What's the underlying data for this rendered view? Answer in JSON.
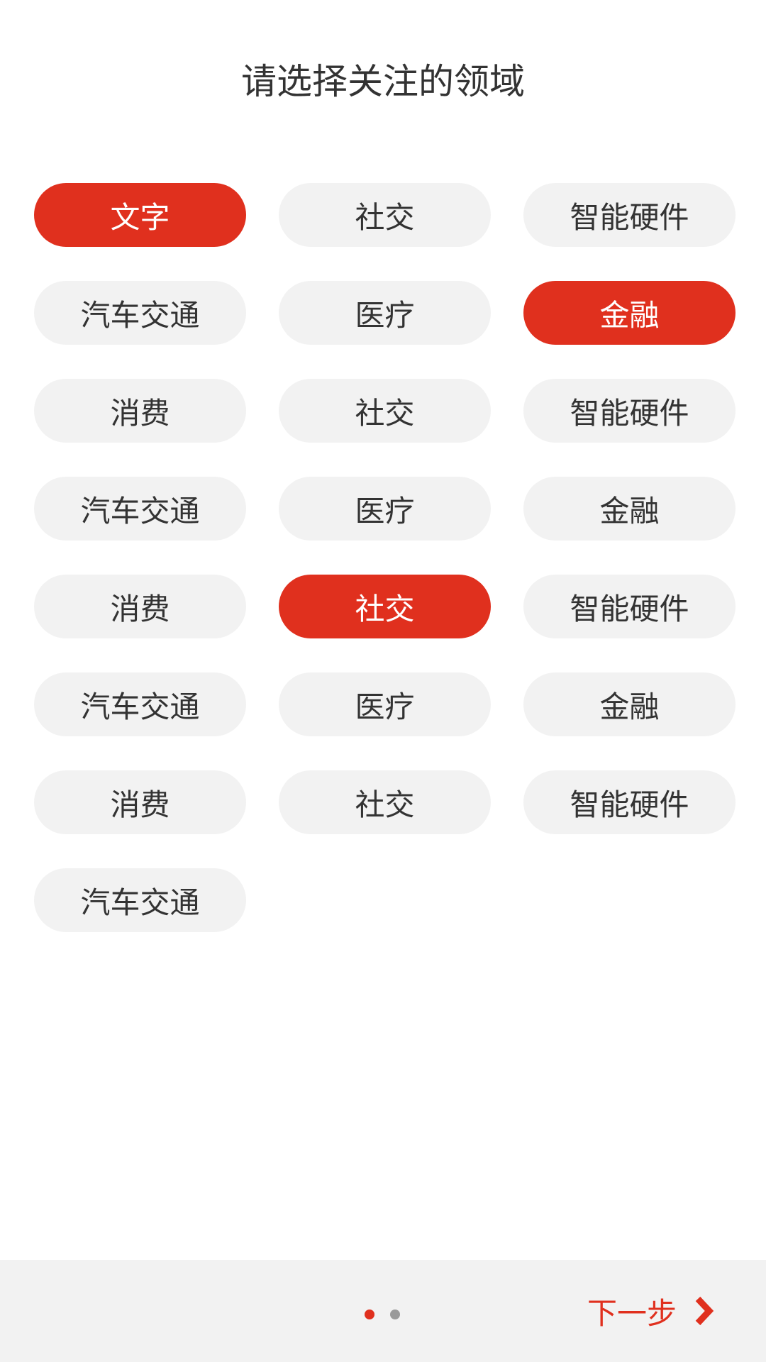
{
  "title": "请选择关注的领域",
  "colors": {
    "accent": "#e0301e",
    "tag_bg": "#f2f2f2",
    "footer_bg": "#f2f2f2"
  },
  "tags": [
    {
      "label": "文字",
      "selected": true
    },
    {
      "label": "社交",
      "selected": false
    },
    {
      "label": "智能硬件",
      "selected": false
    },
    {
      "label": "汽车交通",
      "selected": false
    },
    {
      "label": "医疗",
      "selected": false
    },
    {
      "label": "金融",
      "selected": true
    },
    {
      "label": "消费",
      "selected": false
    },
    {
      "label": "社交",
      "selected": false
    },
    {
      "label": "智能硬件",
      "selected": false
    },
    {
      "label": "汽车交通",
      "selected": false
    },
    {
      "label": "医疗",
      "selected": false
    },
    {
      "label": "金融",
      "selected": false
    },
    {
      "label": "消费",
      "selected": false
    },
    {
      "label": "社交",
      "selected": true
    },
    {
      "label": "智能硬件",
      "selected": false
    },
    {
      "label": "汽车交通",
      "selected": false
    },
    {
      "label": "医疗",
      "selected": false
    },
    {
      "label": "金融",
      "selected": false
    },
    {
      "label": "消费",
      "selected": false
    },
    {
      "label": "社交",
      "selected": false
    },
    {
      "label": "智能硬件",
      "selected": false
    },
    {
      "label": "汽车交通",
      "selected": false
    }
  ],
  "footer": {
    "page_indicator": {
      "total": 2,
      "current": 1
    },
    "next_label": "下一步",
    "next_icon": "chevron-right-icon"
  }
}
